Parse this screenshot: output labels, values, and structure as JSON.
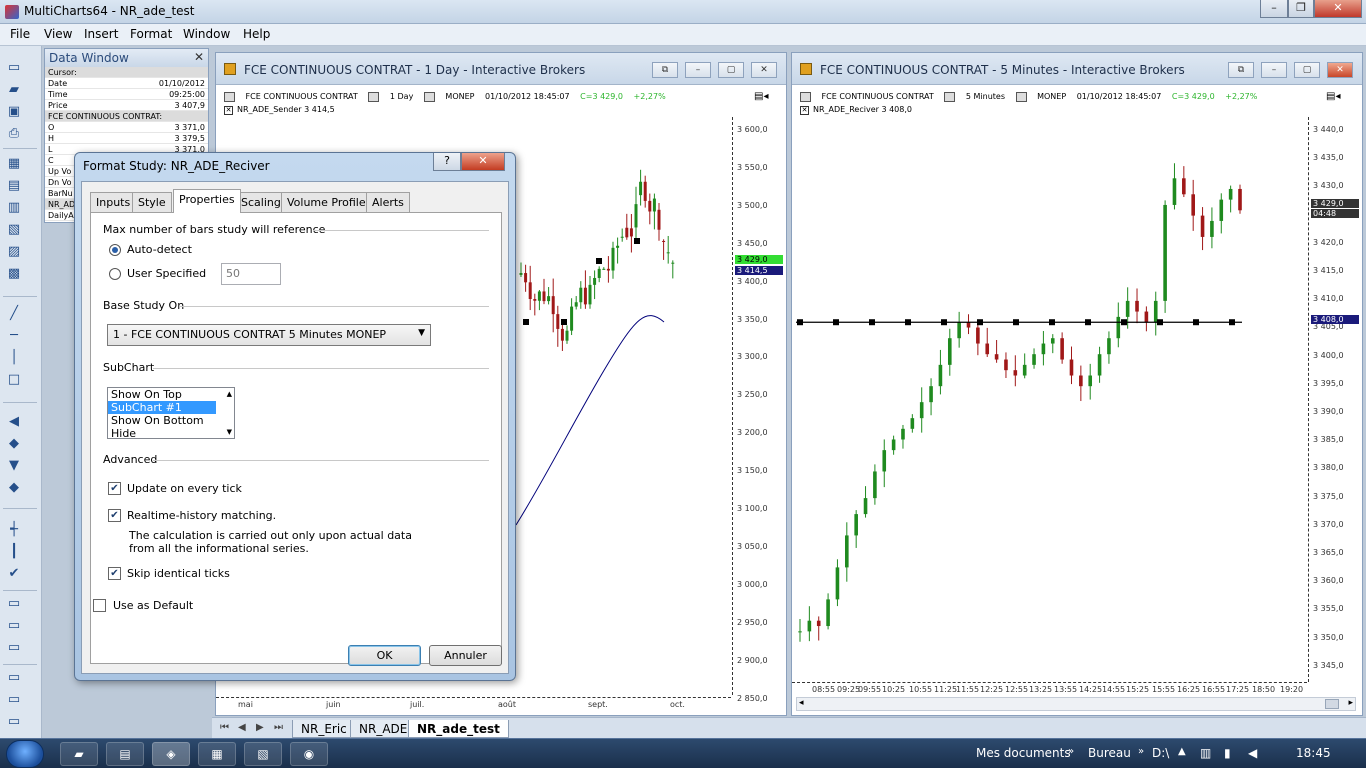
{
  "app": {
    "title": "MultiCharts64 - NR_ade_test"
  },
  "menu": [
    "File",
    "View",
    "Insert",
    "Format",
    "Window",
    "Help"
  ],
  "data_window": {
    "title": "Data Window",
    "rows": [
      {
        "label": "Cursor:",
        "value": "",
        "section": true
      },
      {
        "label": "Date",
        "value": "01/10/2012"
      },
      {
        "label": "Time",
        "value": "09:25:00"
      },
      {
        "label": "Price",
        "value": "3 407,9"
      },
      {
        "label": "FCE CONTINUOUS CONTRAT:",
        "value": "",
        "section": true
      },
      {
        "label": "O",
        "value": "3 371,0"
      },
      {
        "label": "H",
        "value": "3 379,5"
      },
      {
        "label": "L",
        "value": "3 371,0"
      },
      {
        "label": "C",
        "value": ""
      },
      {
        "label": "Up Vo",
        "value": ""
      },
      {
        "label": "Dn Vo",
        "value": ""
      },
      {
        "label": "BarNu",
        "value": ""
      },
      {
        "label": "NR_AD",
        "value": "",
        "section": true
      },
      {
        "label": "DailyA",
        "value": ""
      }
    ]
  },
  "chart_left": {
    "title": "FCE CONTINUOUS CONTRAT - 1 Day - Interactive Brokers",
    "info": {
      "symbol": "FCE CONTINUOUS CONTRAT",
      "interval": "1 Day",
      "exchange": "MONEP",
      "datetime": "01/10/2012  18:45:07",
      "last": "C=3 429,0",
      "change": "+2,27%"
    },
    "study": "NR_ADE_Sender  3 414,5",
    "y_ticks": [
      "3 600,0",
      "3 550,0",
      "3 500,0",
      "3 450,0",
      "3 400,0",
      "3 350,0",
      "3 300,0",
      "3 250,0",
      "3 200,0",
      "3 150,0",
      "3 100,0",
      "3 050,0",
      "3 000,0",
      "2 950,0",
      "2 900,0",
      "2 850,0"
    ],
    "price_tags": [
      {
        "text": "3 429,0",
        "color": "#33dd33"
      },
      {
        "text": "3 414,5",
        "color": "#1a1a7a"
      }
    ],
    "x_ticks": [
      "mai",
      "juin",
      "juil.",
      "août",
      "sept.",
      "oct."
    ]
  },
  "chart_right": {
    "title": "FCE CONTINUOUS CONTRAT - 5 Minutes - Interactive Brokers",
    "info": {
      "symbol": "FCE CONTINUOUS CONTRAT",
      "interval": "5 Minutes",
      "exchange": "MONEP",
      "datetime": "01/10/2012  18:45:07",
      "last": "C=3 429,0",
      "change": "+2,27%"
    },
    "study": "NR_ADE_Reciver  3 408,0",
    "y_ticks": [
      "3 440,0",
      "3 435,0",
      "3 430,0",
      "3 425,0",
      "3 420,0",
      "3 415,0",
      "3 410,0",
      "3 405,0",
      "3 400,0",
      "3 395,0",
      "3 390,0",
      "3 385,0",
      "3 380,0",
      "3 375,0",
      "3 370,0",
      "3 365,0",
      "3 360,0",
      "3 355,0",
      "3 350,0",
      "3 345,0"
    ],
    "price_tags": [
      {
        "text": "3 429,0",
        "color": "#333333"
      },
      {
        "text": "04:48",
        "color": "#333333"
      },
      {
        "text": "3 408,0",
        "color": "#1a1a7a"
      }
    ],
    "x_ticks": [
      "08:55",
      "09:25",
      "09:55",
      "10:25",
      "10:55",
      "11:25",
      "11:55",
      "12:25",
      "12:55",
      "13:25",
      "13:55",
      "14:25",
      "14:55",
      "15:25",
      "15:55",
      "16:25",
      "16:55",
      "17:25",
      "18:50",
      "19:20"
    ]
  },
  "colors": {
    "up": "#1f8a1f",
    "down": "#a01818",
    "study_line": "#000000",
    "ma_line": "#00007a"
  },
  "dialog": {
    "title": "Format Study: NR_ADE_Reciver",
    "help_btn": "?",
    "close_btn": "✕",
    "tabs": [
      "Inputs",
      "Style",
      "Properties",
      "Scaling",
      "Volume Profile",
      "Alerts"
    ],
    "active_tab": "Properties",
    "max_bars_header": "Max number of bars study will reference",
    "auto_detect": "Auto-detect",
    "user_specified": "User Specified",
    "user_value": "50",
    "base_study_header": "Base Study On",
    "base_study_value": "1 - FCE CONTINUOUS CONTRAT 5 Minutes MONEP",
    "subchart_header": "SubChart",
    "subchart_options": [
      "Show On Top",
      "SubChart #1",
      "Show On Bottom",
      "Hide"
    ],
    "subchart_selected": "SubChart #1",
    "advanced_header": "Advanced",
    "update_every_tick": "Update on every tick",
    "realtime_history": "Realtime-history matching.",
    "realtime_note_1": "The calculation is carried out only upon actual data",
    "realtime_note_2": "from all the informational series.",
    "skip_identical": "Skip identical ticks",
    "use_default": "Use as Default",
    "ok": "OK",
    "cancel": "Annuler"
  },
  "sheet_tabs": [
    "NR_Eric",
    "NR_ADE",
    "NR_ade_test"
  ],
  "active_sheet": "NR_ade_test",
  "taskbar": {
    "tray_folder_1": "Mes documents",
    "tray_folder_2": "Bureau",
    "tray_drive": "D:\\",
    "clock": "18:45"
  }
}
